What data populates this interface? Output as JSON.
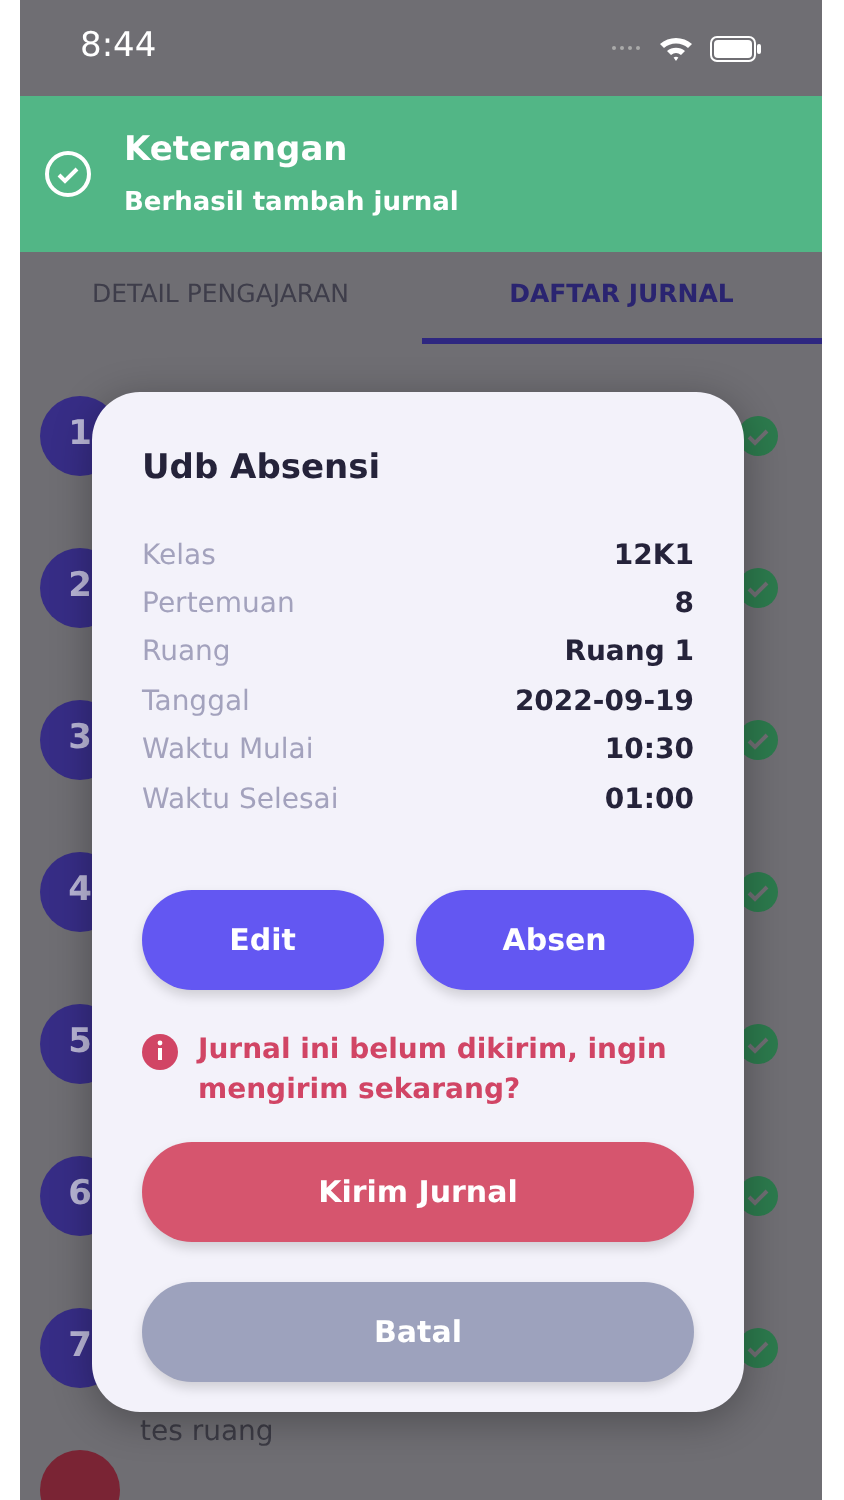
{
  "status_bar": {
    "time": "8:44"
  },
  "toast": {
    "title": "Keterangan",
    "message": "Berhasil tambah jurnal"
  },
  "tabs": [
    {
      "label": "DETAIL PENGAJARAN",
      "selected": false
    },
    {
      "label": "DAFTAR JURNAL",
      "selected": true
    }
  ],
  "journal_list": [
    {
      "number": "1",
      "kind": "sent"
    },
    {
      "number": "2",
      "kind": "sent"
    },
    {
      "number": "3",
      "kind": "sent"
    },
    {
      "number": "4",
      "kind": "sent"
    },
    {
      "number": "5",
      "kind": "sent"
    },
    {
      "number": "6",
      "kind": "sent"
    },
    {
      "number": "7",
      "kind": "sent",
      "subtitle": "tes ruang"
    },
    {
      "kind": "pending"
    }
  ],
  "dialog": {
    "title": "Udb Absensi",
    "details": [
      {
        "label": "Kelas",
        "value": "12K1"
      },
      {
        "label": "Pertemuan",
        "value": "8"
      },
      {
        "label": "Ruang",
        "value": "Ruang 1"
      },
      {
        "label": "Tanggal",
        "value": "2022-09-19"
      },
      {
        "label": "Waktu Mulai",
        "value": "10:30"
      },
      {
        "label": "Waktu Selesai",
        "value": "01:00"
      }
    ],
    "actions": [
      "Edit",
      "Absen"
    ],
    "warning": "Jurnal ini belum dikirim, ingin mengirim sekarang?",
    "buttons": [
      {
        "label": "Kirim Jurnal",
        "kind": "primary"
      },
      {
        "label": "Batal",
        "kind": "cancel"
      }
    ]
  }
}
